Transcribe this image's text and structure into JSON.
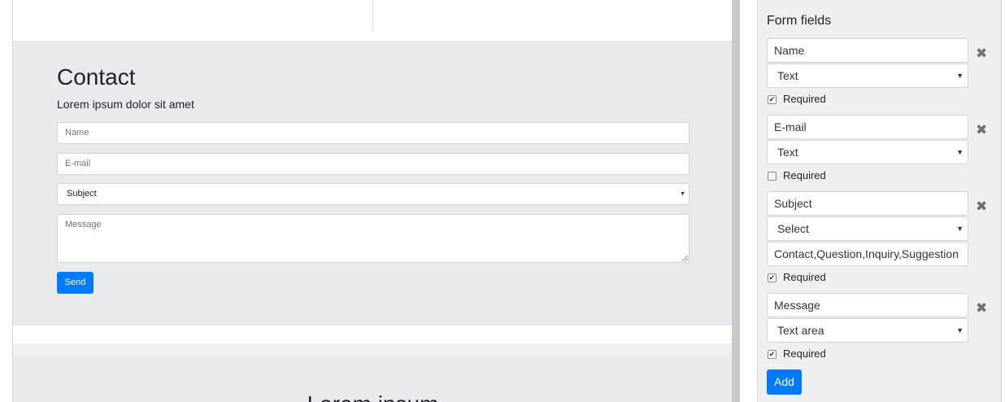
{
  "preview": {
    "contact": {
      "title": "Contact",
      "subtitle": "Lorem ipsum dolor sit amet",
      "name_placeholder": "Name",
      "email_placeholder": "E-mail",
      "subject_selected": "Subject",
      "message_placeholder": "Message",
      "send_label": "Send"
    },
    "next_section_title": "Lorem ipsum"
  },
  "editor": {
    "title": "Form fields",
    "fields": [
      {
        "label": "Name",
        "type": "Text",
        "required_label": "Required",
        "required": true
      },
      {
        "label": "E-mail",
        "type": "Text",
        "required_label": "Required",
        "required": false
      },
      {
        "label": "Subject",
        "type": "Select",
        "options": "Contact,Question,Inquiry,Suggestion",
        "required_label": "Required",
        "required": true
      },
      {
        "label": "Message",
        "type": "Text area",
        "required_label": "Required",
        "required": true
      }
    ],
    "add_label": "Add"
  },
  "icons": {
    "remove": "close-icon",
    "select_caret": "caret-down-icon",
    "checkbox_check": "checkmark-icon"
  },
  "colors": {
    "primary_button": "#007bff",
    "section_background": "#e8eaed",
    "editor_background": "#efefef"
  }
}
